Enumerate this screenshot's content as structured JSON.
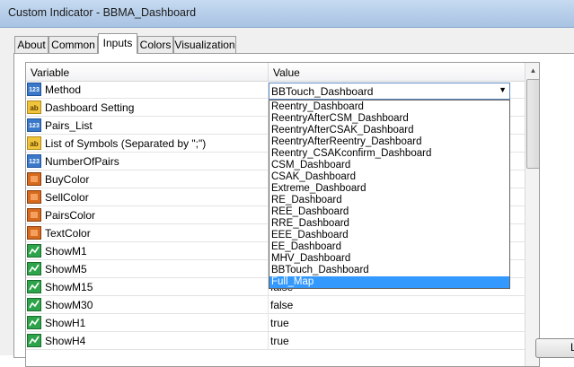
{
  "window": {
    "title": "Custom Indicator - BBMA_Dashboard"
  },
  "tabs": [
    {
      "label": "About"
    },
    {
      "label": "Common"
    },
    {
      "label": "Inputs"
    },
    {
      "label": "Colors"
    },
    {
      "label": "Visualization"
    }
  ],
  "grid": {
    "headers": {
      "variable": "Variable",
      "value": "Value"
    },
    "rows": [
      {
        "icon": "number-icon",
        "name": "Method",
        "value": ""
      },
      {
        "icon": "string-icon",
        "name": "Dashboard Setting",
        "value": ""
      },
      {
        "icon": "number-icon",
        "name": "Pairs_List",
        "value": ""
      },
      {
        "icon": "string-icon",
        "name": "List of Symbols (Separated by \";\")",
        "value": ""
      },
      {
        "icon": "number-icon",
        "name": "NumberOfPairs",
        "value": ""
      },
      {
        "icon": "color-icon",
        "name": "BuyColor",
        "value": ""
      },
      {
        "icon": "color-icon",
        "name": "SellColor",
        "value": ""
      },
      {
        "icon": "color-icon",
        "name": "PairsColor",
        "value": ""
      },
      {
        "icon": "color-icon",
        "name": "TextColor",
        "value": ""
      },
      {
        "icon": "bool-icon",
        "name": "ShowM1",
        "value": ""
      },
      {
        "icon": "bool-icon",
        "name": "ShowM5",
        "value": ""
      },
      {
        "icon": "bool-icon",
        "name": "ShowM15",
        "value": "false"
      },
      {
        "icon": "bool-icon",
        "name": "ShowM30",
        "value": "false"
      },
      {
        "icon": "bool-icon",
        "name": "ShowH1",
        "value": "true"
      },
      {
        "icon": "bool-icon",
        "name": "ShowH4",
        "value": "true"
      }
    ]
  },
  "method_combo": {
    "selected": "BBTouch_Dashboard",
    "options": [
      "Reentry_Dashboard",
      "ReentryAfterCSM_Dashboard",
      "ReentryAfterCSAK_Dashboard",
      "ReentryAfterReentry_Dashboard",
      "Reentry_CSAKconfirm_Dashboard",
      "CSM_Dashboard",
      "CSAK_Dashboard",
      "Extreme_Dashboard",
      "RE_Dashboard",
      "REE_Dashboard",
      "RRE_Dashboard",
      "EEE_Dashboard",
      "EE_Dashboard",
      "MHV_Dashboard",
      "BBTouch_Dashboard",
      "Full_Map"
    ],
    "highlighted": "Full_Map"
  },
  "icon_text": {
    "number": "123",
    "string": "ab"
  },
  "side_button": {
    "label": "L"
  },
  "colors": {
    "selection": "#3399ff",
    "titlebar": "#b8cfea",
    "combo_border": "#5c8ac3"
  }
}
